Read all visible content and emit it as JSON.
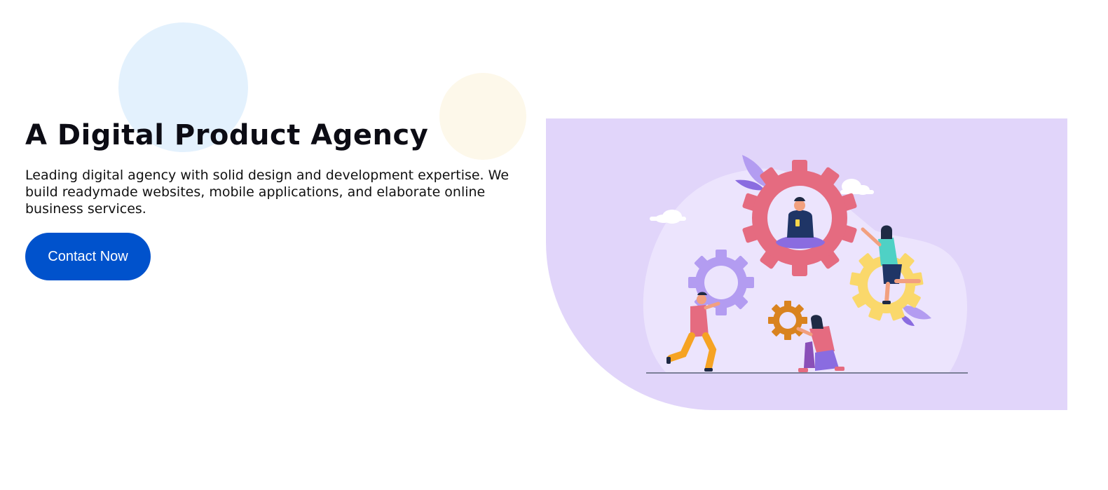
{
  "hero": {
    "title": "A Digital Product Agency",
    "description": "Leading digital agency with solid design and development expertise. We build readymade websites, mobile applications, and elaborate online business services.",
    "cta_label": "Contact Now"
  },
  "colors": {
    "accent": "#0052cc",
    "panel": "#e1d5fa",
    "panel_inner": "#ece4fd",
    "gear_red": "#e56b80",
    "gear_purple": "#b39cf1",
    "gear_yellow": "#fad86b",
    "gear_orange": "#d9831f"
  },
  "illustration": {
    "subject": "people-working-on-gears",
    "icons": [
      "cloud-icon",
      "gear-icon",
      "leaf-icon",
      "person-icon"
    ]
  }
}
